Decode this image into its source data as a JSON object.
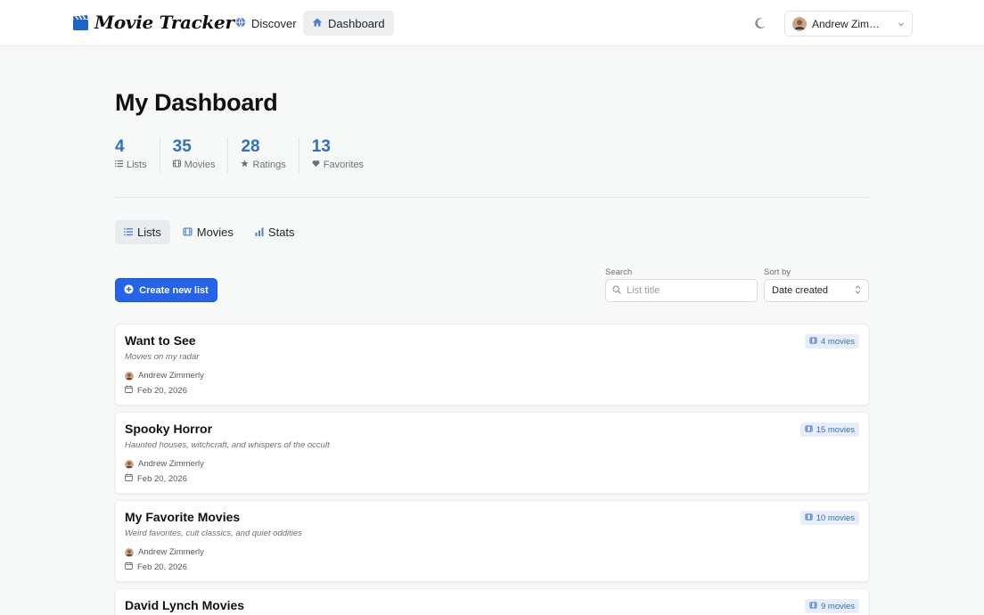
{
  "app": {
    "title": "Movie Tracker"
  },
  "nav": {
    "discover": "Discover",
    "dashboard": "Dashboard"
  },
  "user": {
    "name": "Andrew Zimmerly"
  },
  "page": {
    "title": "My Dashboard"
  },
  "stats": [
    {
      "value": "4",
      "label": "Lists",
      "icon": "list-icon"
    },
    {
      "value": "35",
      "label": "Movies",
      "icon": "film-icon"
    },
    {
      "value": "28",
      "label": "Ratings",
      "icon": "star-icon"
    },
    {
      "value": "13",
      "label": "Favorites",
      "icon": "heart-icon"
    }
  ],
  "tabs": [
    {
      "label": "Lists",
      "icon": "list-icon",
      "active": true
    },
    {
      "label": "Movies",
      "icon": "film-icon",
      "active": false
    },
    {
      "label": "Stats",
      "icon": "bar-chart-icon",
      "active": false
    }
  ],
  "toolbar": {
    "create_label": "Create new list",
    "search_label": "Search",
    "search_placeholder": "List title",
    "search_value": "",
    "sort_label": "Sort by",
    "sort_value": "Date created"
  },
  "lists": [
    {
      "title": "Want to See",
      "description": "Movies on my radar",
      "author": "Andrew Zimmerly",
      "date": "Feb 20, 2026",
      "count": "4 movies"
    },
    {
      "title": "Spooky Horror",
      "description": "Haunted houses, witchcraft, and whispers of the occult",
      "author": "Andrew Zimmerly",
      "date": "Feb 20, 2026",
      "count": "15 movies"
    },
    {
      "title": "My Favorite Movies",
      "description": "Weird favorites, cult classics, and quiet oddities",
      "author": "Andrew Zimmerly",
      "date": "Feb 20, 2026",
      "count": "10 movies"
    },
    {
      "title": "David Lynch Movies",
      "description": "",
      "author": "",
      "date": "",
      "count": "9 movies"
    }
  ],
  "colors": {
    "accent": "#2563eb",
    "stat_value": "#2f6fc4",
    "badge_bg": "#e8eef9"
  }
}
